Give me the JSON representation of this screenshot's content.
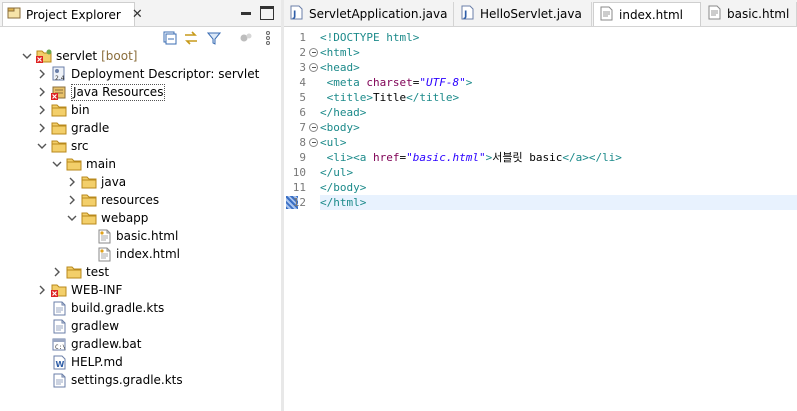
{
  "explorer": {
    "tab_label": "Project Explorer",
    "tab_close": "✕"
  },
  "tree": [
    {
      "label": "servlet",
      "decoration": "[boot]",
      "icon": "project-icon",
      "depth": 0,
      "expanded": true
    },
    {
      "label": "Deployment Descriptor: servlet",
      "icon": "deployment-descriptor-icon",
      "depth": 1,
      "expanded": false
    },
    {
      "label": "Java Resources",
      "icon": "java-resources-icon",
      "depth": 1,
      "expanded": false,
      "selected": true
    },
    {
      "label": "bin",
      "icon": "folder-icon",
      "depth": 1,
      "expanded": false
    },
    {
      "label": "gradle",
      "icon": "folder-icon",
      "depth": 1,
      "expanded": false
    },
    {
      "label": "src",
      "icon": "folder-icon",
      "depth": 1,
      "expanded": true
    },
    {
      "label": "main",
      "icon": "folder-icon",
      "depth": 2,
      "expanded": true
    },
    {
      "label": "java",
      "icon": "folder-icon",
      "depth": 3,
      "expanded": false
    },
    {
      "label": "resources",
      "icon": "folder-icon",
      "depth": 3,
      "expanded": false
    },
    {
      "label": "webapp",
      "icon": "folder-icon",
      "depth": 3,
      "expanded": true
    },
    {
      "label": "basic.html",
      "icon": "html-file-icon",
      "depth": 4
    },
    {
      "label": "index.html",
      "icon": "html-file-icon",
      "depth": 4
    },
    {
      "label": "test",
      "icon": "folder-icon",
      "depth": 2,
      "expanded": false
    },
    {
      "label": "WEB-INF",
      "icon": "error-folder-icon",
      "depth": 1,
      "expanded": false
    },
    {
      "label": "build.gradle.kts",
      "icon": "file-icon",
      "depth": 1
    },
    {
      "label": "gradlew",
      "icon": "file-icon",
      "depth": 1
    },
    {
      "label": "gradlew.bat",
      "icon": "bat-file-icon",
      "depth": 1
    },
    {
      "label": "HELP.md",
      "icon": "markdown-file-icon",
      "depth": 1
    },
    {
      "label": "settings.gradle.kts",
      "icon": "file-icon",
      "depth": 1
    }
  ],
  "editor": {
    "tabs": [
      {
        "label": "ServletApplication.java",
        "icon": "java-file-icon"
      },
      {
        "label": "HelloServlet.java",
        "icon": "java-file-icon"
      },
      {
        "label": "index.html",
        "icon": "html-file-icon",
        "active": true
      },
      {
        "label": "basic.html",
        "icon": "html-file-icon"
      }
    ],
    "lines": [
      {
        "n": "1",
        "fold": false,
        "parts": [
          [
            "tag",
            "<!DOCTYPE html>"
          ]
        ]
      },
      {
        "n": "2",
        "fold": true,
        "parts": [
          [
            "tag",
            "<html>"
          ]
        ]
      },
      {
        "n": "3",
        "fold": true,
        "parts": [
          [
            "tag",
            "<head>"
          ]
        ]
      },
      {
        "n": "4",
        "fold": false,
        "parts": [
          [
            "plain",
            " "
          ],
          [
            "tag",
            "<meta "
          ],
          [
            "attr",
            "charset"
          ],
          [
            "plain",
            "="
          ],
          [
            "val",
            "\"UTF-8\""
          ],
          [
            "tag",
            ">"
          ]
        ]
      },
      {
        "n": "5",
        "fold": false,
        "parts": [
          [
            "plain",
            " "
          ],
          [
            "tag",
            "<title>"
          ],
          [
            "plain",
            "Title"
          ],
          [
            "tag",
            "</title>"
          ]
        ]
      },
      {
        "n": "6",
        "fold": false,
        "parts": [
          [
            "tag",
            "</head>"
          ]
        ]
      },
      {
        "n": "7",
        "fold": true,
        "parts": [
          [
            "tag",
            "<body>"
          ]
        ]
      },
      {
        "n": "8",
        "fold": true,
        "parts": [
          [
            "tag",
            "<ul>"
          ]
        ]
      },
      {
        "n": "9",
        "fold": false,
        "parts": [
          [
            "plain",
            " "
          ],
          [
            "tag",
            "<li><a "
          ],
          [
            "attr",
            "href"
          ],
          [
            "plain",
            "="
          ],
          [
            "val",
            "\"basic.html\""
          ],
          [
            "tag",
            ">"
          ],
          [
            "plain",
            "서블릿 basic"
          ],
          [
            "tag",
            "</a></li>"
          ]
        ]
      },
      {
        "n": "10",
        "fold": false,
        "parts": [
          [
            "tag",
            "</ul>"
          ]
        ]
      },
      {
        "n": "11",
        "fold": false,
        "parts": [
          [
            "tag",
            "</body>"
          ]
        ]
      },
      {
        "n": "12",
        "fold": false,
        "current": true,
        "marker": true,
        "parts": [
          [
            "tag",
            "</html>"
          ]
        ]
      }
    ]
  }
}
